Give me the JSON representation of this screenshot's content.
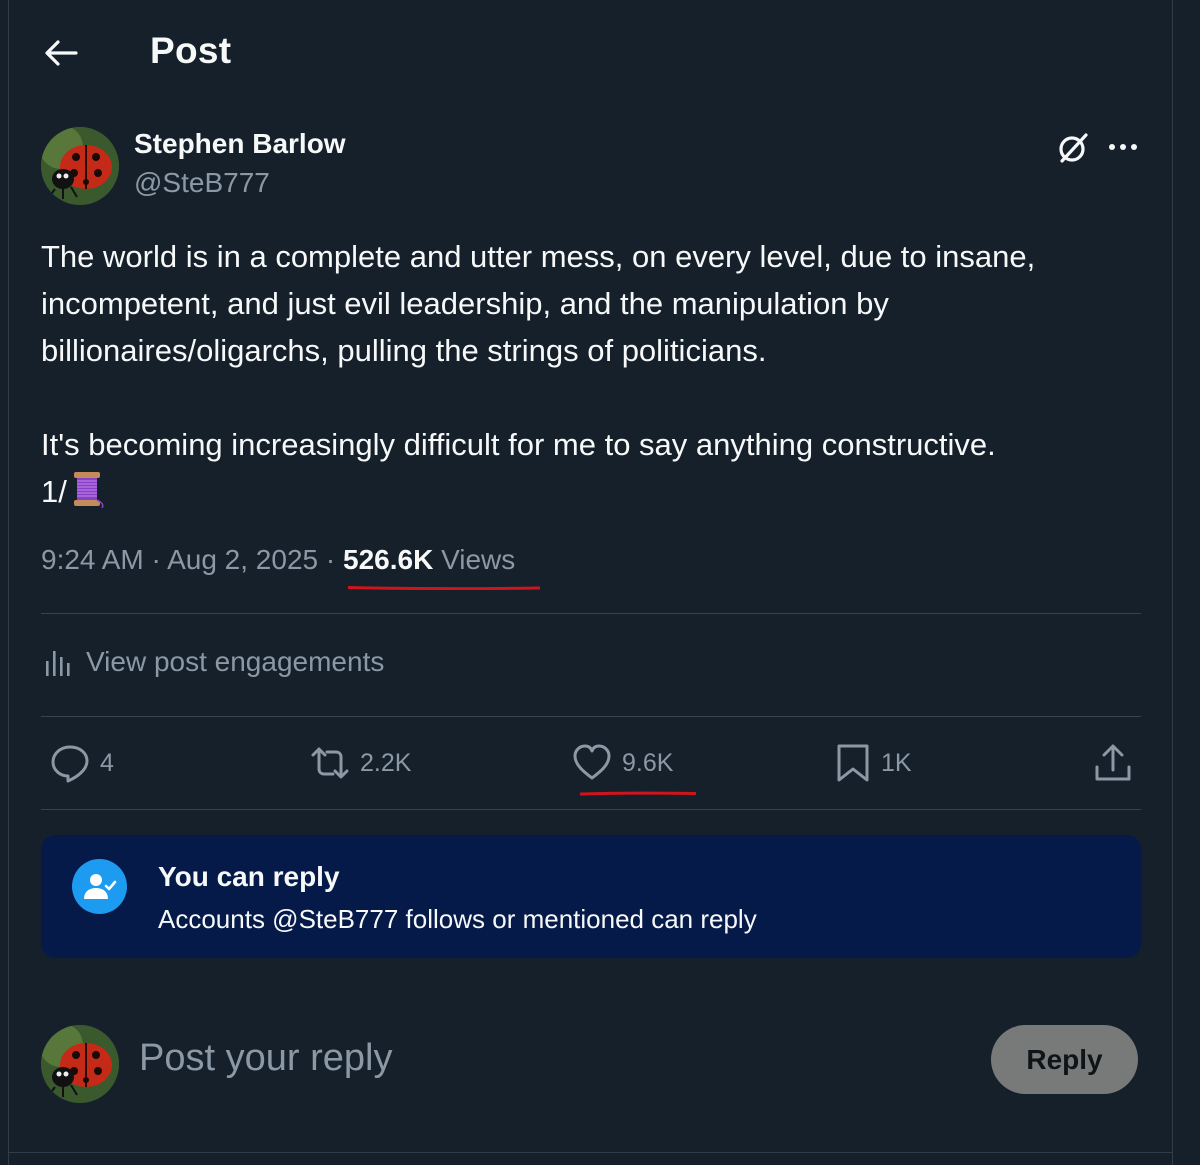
{
  "header": {
    "back_icon": "arrow-left-icon",
    "title": "Post"
  },
  "author": {
    "name": "Stephen Barlow",
    "handle": "@SteB777",
    "avatar": "ladybug-avatar"
  },
  "tweet": {
    "lines_p1": [
      "The world is in a complete and utter mess, on every level, due to insane,",
      "incompetent, and just evil leadership, and the manipulation by",
      "billionaires/oligarchs, pulling the strings of politicians."
    ],
    "line_p2": "It's becoming increasingly difficult for me to say anything constructive.",
    "thread_marker": "1/",
    "thread_emoji": "spool-of-thread-emoji"
  },
  "meta": {
    "time": "9:24 AM",
    "date": "Aug 2, 2025",
    "separator": "·",
    "views_count": "526.6K",
    "views_label": "Views"
  },
  "engagements_label": "View post engagements",
  "actions": {
    "replies": "4",
    "reposts": "2.2K",
    "likes": "9.6K",
    "bookmarks": "1K"
  },
  "reply_restriction": {
    "title": "You can reply",
    "subtitle": "Accounts @SteB777 follows or mentioned can reply"
  },
  "composer": {
    "placeholder": "Post your reply",
    "button": "Reply"
  },
  "colors": {
    "background": "#15202b",
    "accent": "#1d9bf0",
    "annotation": "#d0141c",
    "reply_box": "#061a4a"
  }
}
